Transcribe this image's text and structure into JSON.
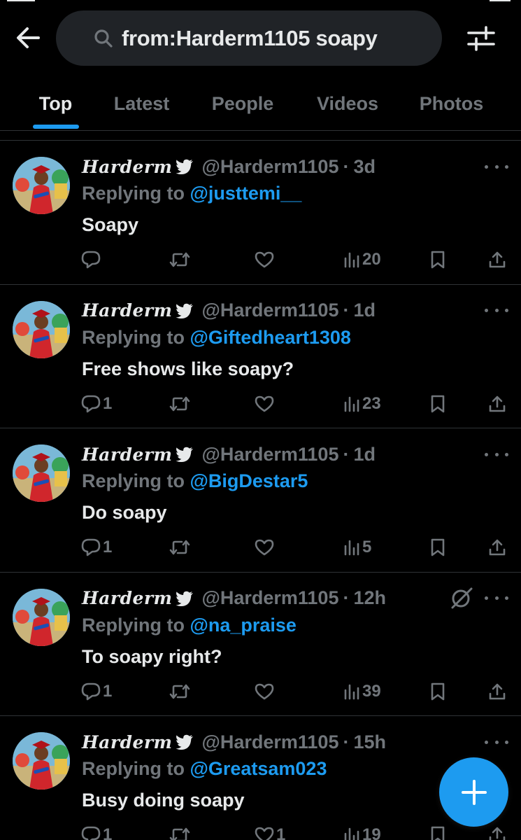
{
  "search": {
    "query": "from:Harderm1105 soapy"
  },
  "tabs": [
    {
      "label": "Top",
      "active": true
    },
    {
      "label": "Latest",
      "active": false
    },
    {
      "label": "People",
      "active": false
    },
    {
      "label": "Videos",
      "active": false
    },
    {
      "label": "Photos",
      "active": false
    }
  ],
  "reply_prefix": "Replying to",
  "tweets": [
    {
      "name": "Harderm",
      "handle": "@Harderm1105",
      "time": "3d",
      "reply_to": "@justtemi__",
      "text": "Soapy",
      "replies": "",
      "retweets": "",
      "likes": "",
      "views": "20",
      "muted": false
    },
    {
      "name": "Harderm",
      "handle": "@Harderm1105",
      "time": "1d",
      "reply_to": "@Giftedheart1308",
      "text": "Free shows like soapy?",
      "replies": "1",
      "retweets": "",
      "likes": "",
      "views": "23",
      "muted": false
    },
    {
      "name": "Harderm",
      "handle": "@Harderm1105",
      "time": "1d",
      "reply_to": "@BigDestar5",
      "text": "Do soapy",
      "replies": "1",
      "retweets": "",
      "likes": "",
      "views": "5",
      "muted": false
    },
    {
      "name": "Harderm",
      "handle": "@Harderm1105",
      "time": "12h",
      "reply_to": "@na_praise",
      "text": "To soapy right?",
      "replies": "1",
      "retweets": "",
      "likes": "",
      "views": "39",
      "muted": true
    },
    {
      "name": "Harderm",
      "handle": "@Harderm1105",
      "time": "15h",
      "reply_to": "@Greatsam023",
      "text": "Busy doing soapy",
      "replies": "1",
      "retweets": "",
      "likes": "1",
      "views": "19",
      "muted": false
    }
  ],
  "icons": {
    "back": "arrow-left-icon",
    "search": "search-icon",
    "filter": "sliders-icon",
    "verified": "bird-icon",
    "more": "more-horizontal-icon",
    "reply": "comment-icon",
    "retweet": "retweet-icon",
    "like": "heart-icon",
    "views": "analytics-icon",
    "bookmark": "bookmark-icon",
    "share": "share-icon",
    "compose": "plus-icon"
  },
  "colors": {
    "accent": "#1d9bf0",
    "background": "#000000",
    "muted_text": "#71767b",
    "text": "#e7e9ea"
  }
}
